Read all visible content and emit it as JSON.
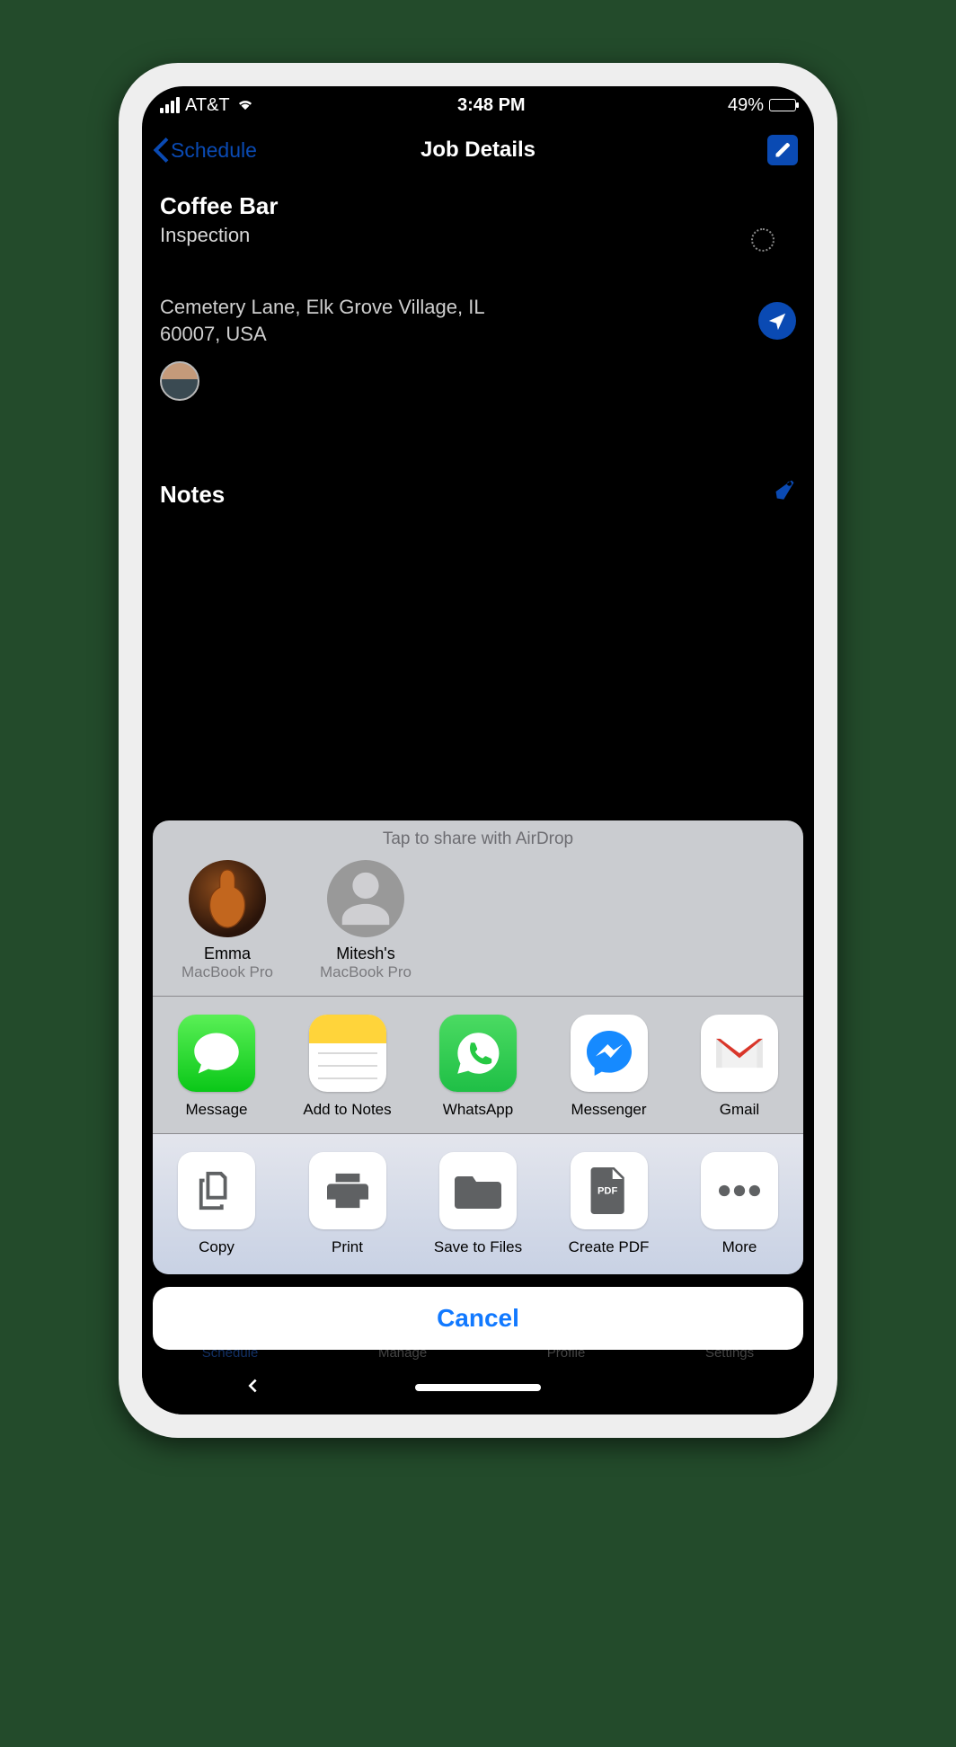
{
  "statusbar": {
    "carrier": "AT&T",
    "time": "3:48 PM",
    "battery_pct": "49%"
  },
  "navbar": {
    "back_label": "Schedule",
    "title": "Job Details"
  },
  "job": {
    "title": "Coffee Bar",
    "type": "Inspection",
    "address_line1": "Cemetery Lane, Elk Grove Village, IL",
    "address_line2": "60007, USA"
  },
  "sections": {
    "notes_label": "Notes"
  },
  "share_sheet": {
    "airdrop_header": "Tap to share with AirDrop",
    "airdrop": [
      {
        "name": "Emma",
        "device": "MacBook Pro"
      },
      {
        "name": "Mitesh's",
        "device": "MacBook Pro"
      }
    ],
    "apps": [
      {
        "label": "Message"
      },
      {
        "label": "Add to Notes"
      },
      {
        "label": "WhatsApp"
      },
      {
        "label": "Messenger"
      },
      {
        "label": "Gmail"
      }
    ],
    "actions": [
      {
        "label": "Copy"
      },
      {
        "label": "Print"
      },
      {
        "label": "Save to Files"
      },
      {
        "label": "Create PDF"
      },
      {
        "label": "More"
      }
    ],
    "cancel_label": "Cancel"
  },
  "tabbar": {
    "items": [
      "Schedule",
      "Manage",
      "Profile",
      "Settings"
    ]
  }
}
